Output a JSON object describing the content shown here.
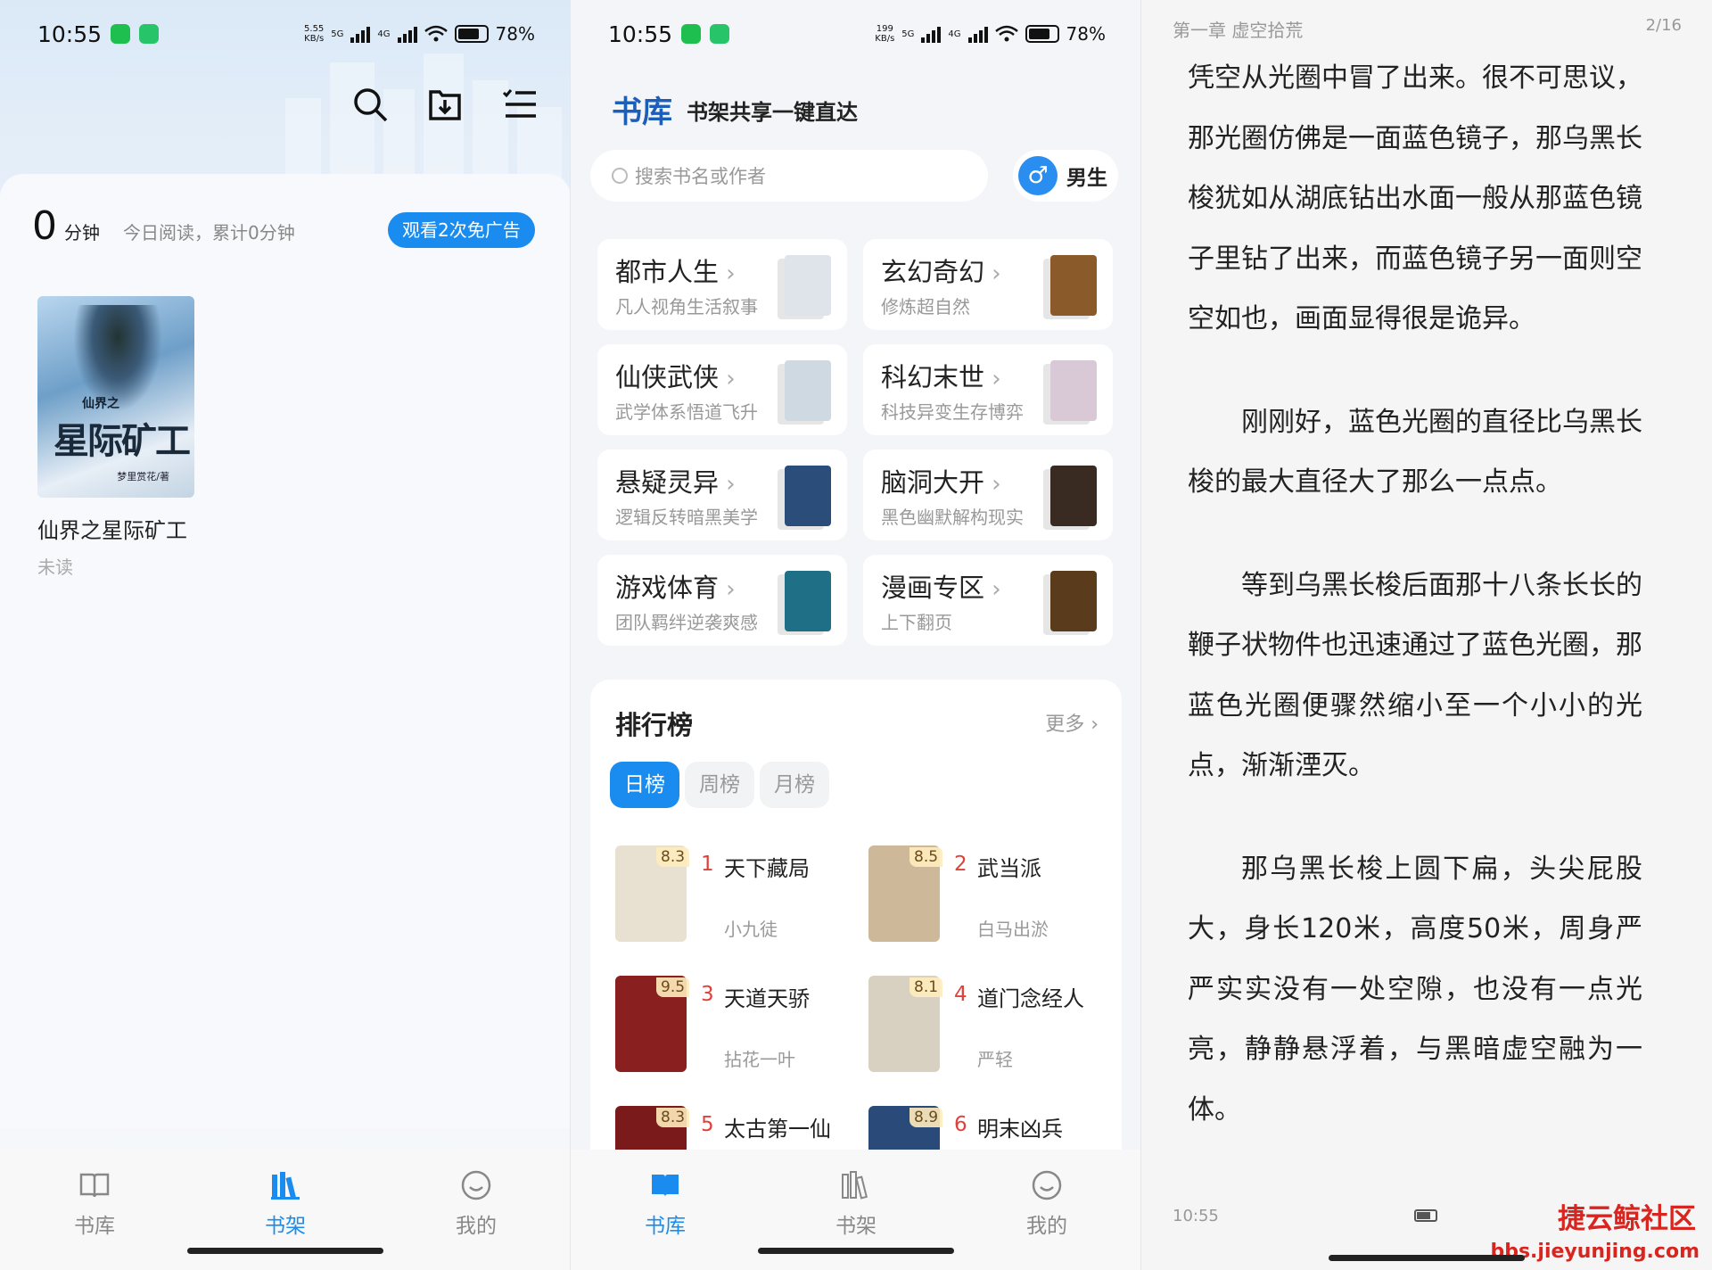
{
  "status": {
    "left": {
      "time": "10:55",
      "net_speed": "5.55\nKB/s",
      "battery": "78%"
    },
    "middle": {
      "time": "10:55",
      "net_speed": "199\nKB/s",
      "battery": "78%"
    },
    "net_types": [
      "5G",
      "4G"
    ]
  },
  "shelf": {
    "minutes_value": "0",
    "minutes_unit": "分钟",
    "minutes_desc": "今日阅读，累计0分钟",
    "ad_button": "观看2次免广告",
    "book": {
      "cover_title": "星际矿工",
      "cover_prefix": "仙界之",
      "cover_author": "梦里赏花/著",
      "title": "仙界之星际矿工",
      "status": "未读"
    },
    "tabs": [
      {
        "label": "书库"
      },
      {
        "label": "书架"
      },
      {
        "label": "我的"
      }
    ]
  },
  "library": {
    "title": "书库",
    "subtitle": "书架共享一键直达",
    "search_placeholder": "搜索书名或作者",
    "gender": "男生",
    "gender_icon": "♂",
    "categories": [
      {
        "name": "都市人生",
        "desc": "凡人视角生活叙事",
        "color": "#dfe4ea"
      },
      {
        "name": "玄幻奇幻",
        "desc": "修炼超自然",
        "color": "#8a5a2b"
      },
      {
        "name": "仙侠武侠",
        "desc": "武学体系悟道飞升",
        "color": "#cfd9e2"
      },
      {
        "name": "科幻末世",
        "desc": "科技异变生存博弈",
        "color": "#d9c8d6"
      },
      {
        "name": "悬疑灵异",
        "desc": "逻辑反转暗黑美学",
        "color": "#2b4d7a"
      },
      {
        "name": "脑洞大开",
        "desc": "黑色幽默解构现实",
        "color": "#3a2b22"
      },
      {
        "name": "游戏体育",
        "desc": "团队羁绊逆袭爽感",
        "color": "#1f6f86"
      },
      {
        "name": "漫画专区",
        "desc": "上下翻页",
        "color": "#5a3b1c"
      }
    ],
    "ranking": {
      "title": "排行榜",
      "more": "更多 ›",
      "tabs": [
        "日榜",
        "周榜",
        "月榜"
      ],
      "items": [
        {
          "rank": "1",
          "title": "天下藏局",
          "author": "小九徒",
          "score": "8.3",
          "color": "#e8e0d0"
        },
        {
          "rank": "2",
          "title": "武当派",
          "author": "白马出淤",
          "score": "8.5",
          "color": "#cdb99a"
        },
        {
          "rank": "3",
          "title": "天道天骄",
          "author": "拈花一叶",
          "score": "9.5",
          "color": "#8a1f1f"
        },
        {
          "rank": "4",
          "title": "道门念经人",
          "author": "严轻",
          "score": "8.1",
          "color": "#d8d0c0"
        },
        {
          "rank": "5",
          "title": "太古第一仙",
          "author": "",
          "score": "8.3",
          "color": "#7a1a1a"
        },
        {
          "rank": "6",
          "title": "明末凶兵",
          "author": "",
          "score": "8.9",
          "color": "#2a4a7a"
        }
      ]
    },
    "tabs": [
      {
        "label": "书库"
      },
      {
        "label": "书架"
      },
      {
        "label": "我的"
      }
    ]
  },
  "reader": {
    "chapter": "第一章 虚空拾荒",
    "page": "2/16",
    "paragraphs": [
      {
        "text": "凭空从光圈中冒了出来。很不可思议，那光圈仿佛是一面蓝色镜子，那乌黑长梭犹如从湖底钻出水面一般从那蓝色镜子里钻了出来，而蓝色镜子另一面则空空如也，画面显得很是诡异。",
        "indent": false
      },
      {
        "text": "刚刚好，蓝色光圈的直径比乌黑长梭的最大直径大了那么一点点。",
        "indent": true
      },
      {
        "text": "等到乌黑长梭后面那十八条长长的鞭子状物件也迅速通过了蓝色光圈，那蓝色光圈便骤然缩小至一个小小的光点，渐渐湮灭。",
        "indent": true
      },
      {
        "text": "那乌黑长梭上圆下扁，头尖屁股大，身长120米，高度50米，周身严严实实没有一处空隙，也没有一点光亮，静静悬浮着，与黑暗虚空融为一体。",
        "indent": true
      }
    ],
    "time": "10:55",
    "watermark_cn": "捷云鲸社区",
    "watermark_url": "bbs.jieyunjing.com"
  }
}
